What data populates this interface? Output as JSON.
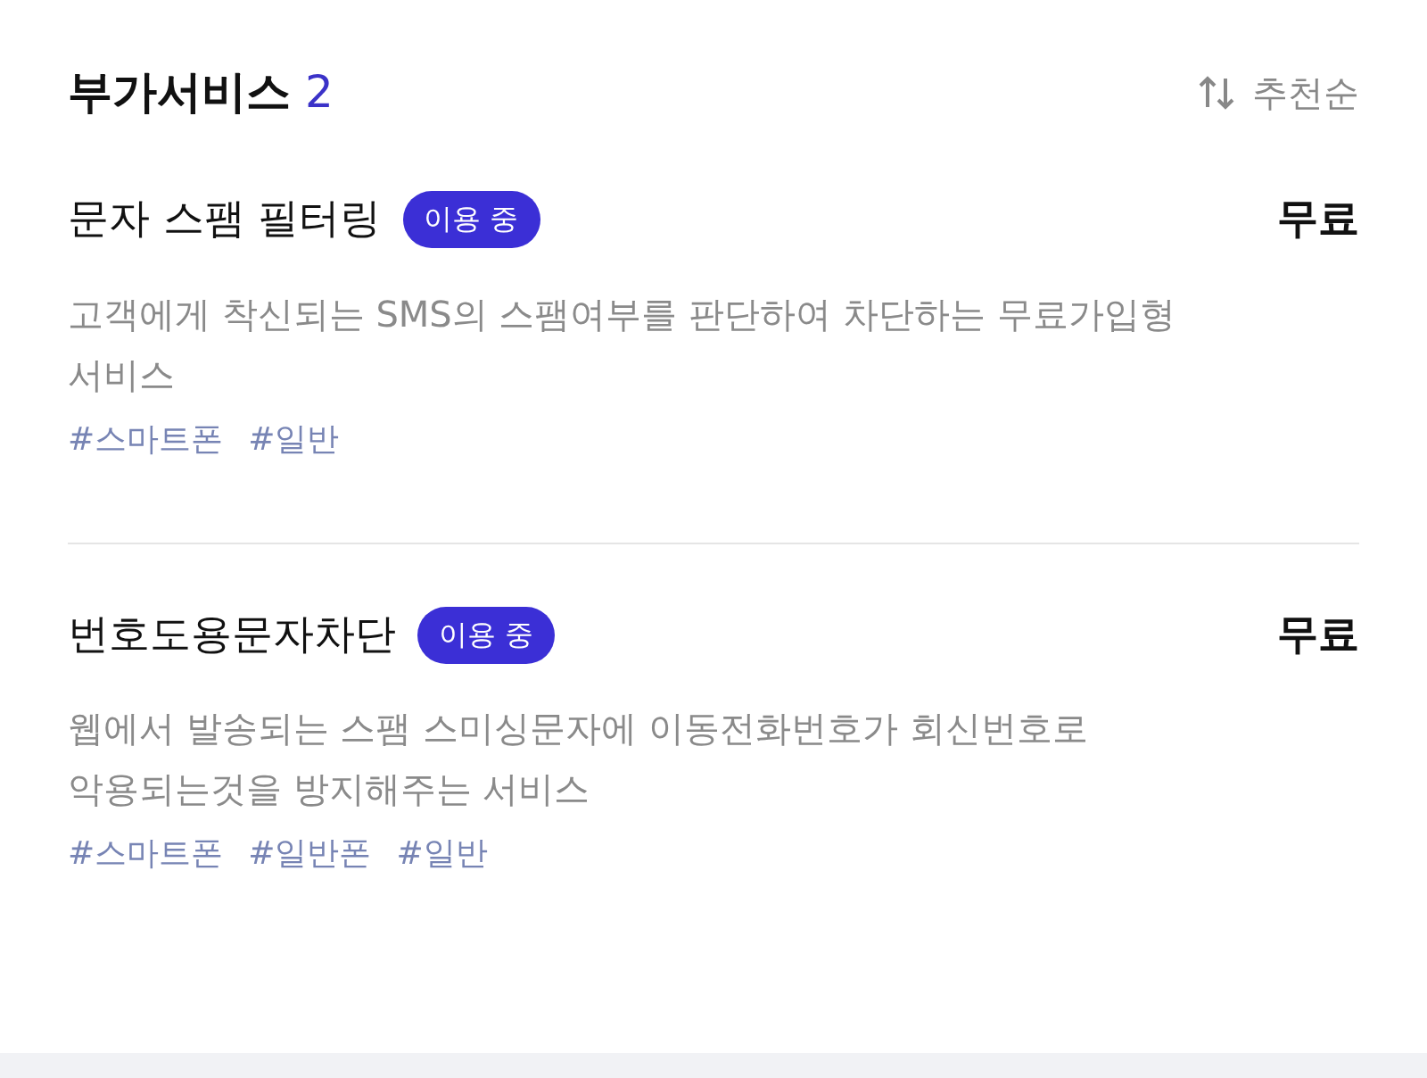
{
  "header": {
    "title": "부가서비스",
    "count": "2",
    "sort": "추천순"
  },
  "services": [
    {
      "name": "문자 스팸 필터링",
      "badge": "이용 중",
      "price": "무료",
      "description": "고객에게 착신되는 SMS의 스팸여부를 판단하여 차단하는 무료가입형 서비스",
      "tags": [
        "#스마트폰",
        "#일반"
      ]
    },
    {
      "name": "번호도용문자차단",
      "badge": "이용 중",
      "price": "무료",
      "description": "웹에서 발송되는 스팸 스미싱문자에 이동전화번호가 회신번호로 악용되는것을 방지해주는 서비스",
      "tags": [
        "#스마트폰",
        "#일반폰",
        "#일반"
      ]
    }
  ]
}
